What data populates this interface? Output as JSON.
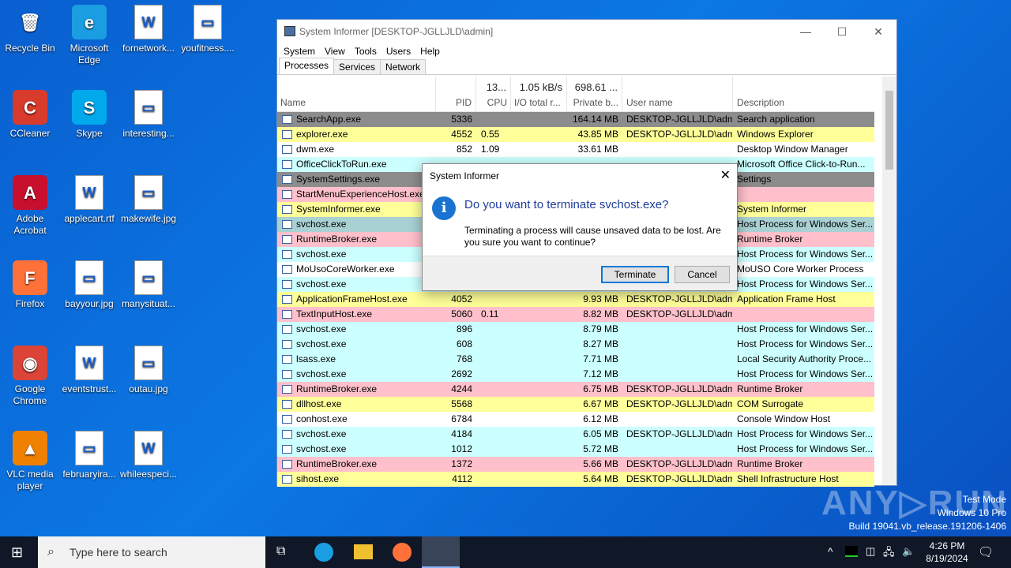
{
  "desktop": {
    "icons": [
      {
        "label": "Recycle Bin",
        "glyph": "🗑",
        "bg": "transparent"
      },
      {
        "label": "Microsoft Edge",
        "glyph": "e",
        "bg": "#1b9de2"
      },
      {
        "label": "fornetwork...",
        "glyph": "W",
        "bg": "doc"
      },
      {
        "label": "youfitness....",
        "glyph": "▭",
        "bg": "doc"
      },
      {
        "label": "CCleaner",
        "glyph": "C",
        "bg": "#d83b2b"
      },
      {
        "label": "Skype",
        "glyph": "S",
        "bg": "#00a9ec"
      },
      {
        "label": "interesting...",
        "glyph": "▭",
        "bg": "doc"
      },
      {
        "label": "Adobe Acrobat",
        "glyph": "A",
        "bg": "#c8102e"
      },
      {
        "label": "applecart.rtf",
        "glyph": "W",
        "bg": "doc"
      },
      {
        "label": "makewife.jpg",
        "glyph": "▭",
        "bg": "doc"
      },
      {
        "label": "Firefox",
        "glyph": "F",
        "bg": "#ff7139"
      },
      {
        "label": "bayyour.jpg",
        "glyph": "▭",
        "bg": "doc"
      },
      {
        "label": "manysituat...",
        "glyph": "▭",
        "bg": "doc"
      },
      {
        "label": "Google Chrome",
        "glyph": "◉",
        "bg": "#db4437"
      },
      {
        "label": "eventstrust...",
        "glyph": "W",
        "bg": "doc"
      },
      {
        "label": "outau.jpg",
        "glyph": "▭",
        "bg": "doc"
      },
      {
        "label": "VLC media player",
        "glyph": "▲",
        "bg": "#f08000"
      },
      {
        "label": "februaryira...",
        "glyph": "▭",
        "bg": "doc"
      },
      {
        "label": "whileespeci...",
        "glyph": "W",
        "bg": "doc"
      }
    ]
  },
  "window": {
    "title": "System Informer [DESKTOP-JGLLJLD\\admin]",
    "menu": [
      "System",
      "View",
      "Tools",
      "Users",
      "Help"
    ],
    "tabs": [
      "Processes",
      "Services",
      "Network"
    ],
    "columns": {
      "name": "Name",
      "pid": "PID",
      "cpu_top": "13...",
      "cpu": "CPU",
      "io_top": "1.05 kB/s",
      "io": "I/O total r...",
      "priv_top": "698.61 ...",
      "priv": "Private b...",
      "user": "User name",
      "desc": "Description"
    },
    "rows": [
      [
        "SearchApp.exe",
        "5336",
        "",
        "164.14 MB",
        "DESKTOP-JGLLJLD\\admi",
        "Search application",
        "#8c8c8c"
      ],
      [
        "explorer.exe",
        "4552",
        "0.55",
        "43.85 MB",
        "DESKTOP-JGLLJLD\\admi",
        "Windows Explorer",
        "#ffff99"
      ],
      [
        "dwm.exe",
        "852",
        "1.09",
        "33.61 MB",
        "",
        "Desktop Window Manager",
        "#ffffff"
      ],
      [
        "OfficeClickToRun.exe",
        "",
        "",
        "",
        "",
        "Microsoft Office Click-to-Run...",
        "#ccffff"
      ],
      [
        "SystemSettings.exe",
        "",
        "",
        "",
        "",
        "Settings",
        "#8c8c8c"
      ],
      [
        "StartMenuExperienceHost.exe",
        "",
        "",
        "",
        "",
        "",
        "#ffc0cb"
      ],
      [
        "SystemInformer.exe",
        "",
        "",
        "",
        "",
        "System Informer",
        "#ffff99"
      ],
      [
        "svchost.exe",
        "",
        "",
        "",
        "",
        "Host Process for Windows Ser...",
        "#a9d1d3"
      ],
      [
        "RuntimeBroker.exe",
        "",
        "",
        "",
        "",
        "Runtime Broker",
        "#ffc0cb"
      ],
      [
        "svchost.exe",
        "",
        "",
        "",
        "",
        "Host Process for Windows Ser...",
        "#ccffff"
      ],
      [
        "MoUsoCoreWorker.exe",
        "",
        "",
        "",
        "",
        "MoUSO Core Worker Process",
        "#ffffff"
      ],
      [
        "svchost.exe",
        "",
        "",
        "",
        "",
        "Host Process for Windows Ser...",
        "#ccffff"
      ],
      [
        "ApplicationFrameHost.exe",
        "4052",
        "",
        "9.93 MB",
        "DESKTOP-JGLLJLD\\admi",
        "Application Frame Host",
        "#ffff99"
      ],
      [
        "TextInputHost.exe",
        "5060",
        "0.11",
        "8.82 MB",
        "DESKTOP-JGLLJLD\\admi",
        "",
        "#ffc0cb"
      ],
      [
        "svchost.exe",
        "896",
        "",
        "8.79 MB",
        "",
        "Host Process for Windows Ser...",
        "#ccffff"
      ],
      [
        "svchost.exe",
        "608",
        "",
        "8.27 MB",
        "",
        "Host Process for Windows Ser...",
        "#ccffff"
      ],
      [
        "lsass.exe",
        "768",
        "",
        "7.71 MB",
        "",
        "Local Security Authority Proce...",
        "#ccffff"
      ],
      [
        "svchost.exe",
        "2692",
        "",
        "7.12 MB",
        "",
        "Host Process for Windows Ser...",
        "#ccffff"
      ],
      [
        "RuntimeBroker.exe",
        "4244",
        "",
        "6.75 MB",
        "DESKTOP-JGLLJLD\\admi",
        "Runtime Broker",
        "#ffc0cb"
      ],
      [
        "dllhost.exe",
        "5568",
        "",
        "6.67 MB",
        "DESKTOP-JGLLJLD\\admi",
        "COM Surrogate",
        "#ffff99"
      ],
      [
        "conhost.exe",
        "6784",
        "",
        "6.12 MB",
        "",
        "Console Window Host",
        "#ffffff"
      ],
      [
        "svchost.exe",
        "4184",
        "",
        "6.05 MB",
        "DESKTOP-JGLLJLD\\admi",
        "Host Process for Windows Ser...",
        "#ccffff"
      ],
      [
        "svchost.exe",
        "1012",
        "",
        "5.72 MB",
        "",
        "Host Process for Windows Ser...",
        "#ccffff"
      ],
      [
        "RuntimeBroker.exe",
        "1372",
        "",
        "5.66 MB",
        "DESKTOP-JGLLJLD\\admi",
        "Runtime Broker",
        "#ffc0cb"
      ],
      [
        "sihost.exe",
        "4112",
        "",
        "5.64 MB",
        "DESKTOP-JGLLJLD\\admi",
        "Shell Infrastructure Host",
        "#ffff99"
      ]
    ]
  },
  "dialog": {
    "title": "System Informer",
    "question": "Do you want to terminate svchost.exe?",
    "message": "Terminating a process will cause unsaved data to be lost. Are you sure you want to continue?",
    "terminate": "Terminate",
    "cancel": "Cancel"
  },
  "taskbar": {
    "search_placeholder": "Type here to search",
    "time": "4:26 PM",
    "date": "8/19/2024"
  },
  "watermark": {
    "logo": "ANY RUN",
    "line1": "Test Mode",
    "line2": "Windows 10 Pro",
    "line3": "Build 19041.vb_release.191206-1406"
  }
}
